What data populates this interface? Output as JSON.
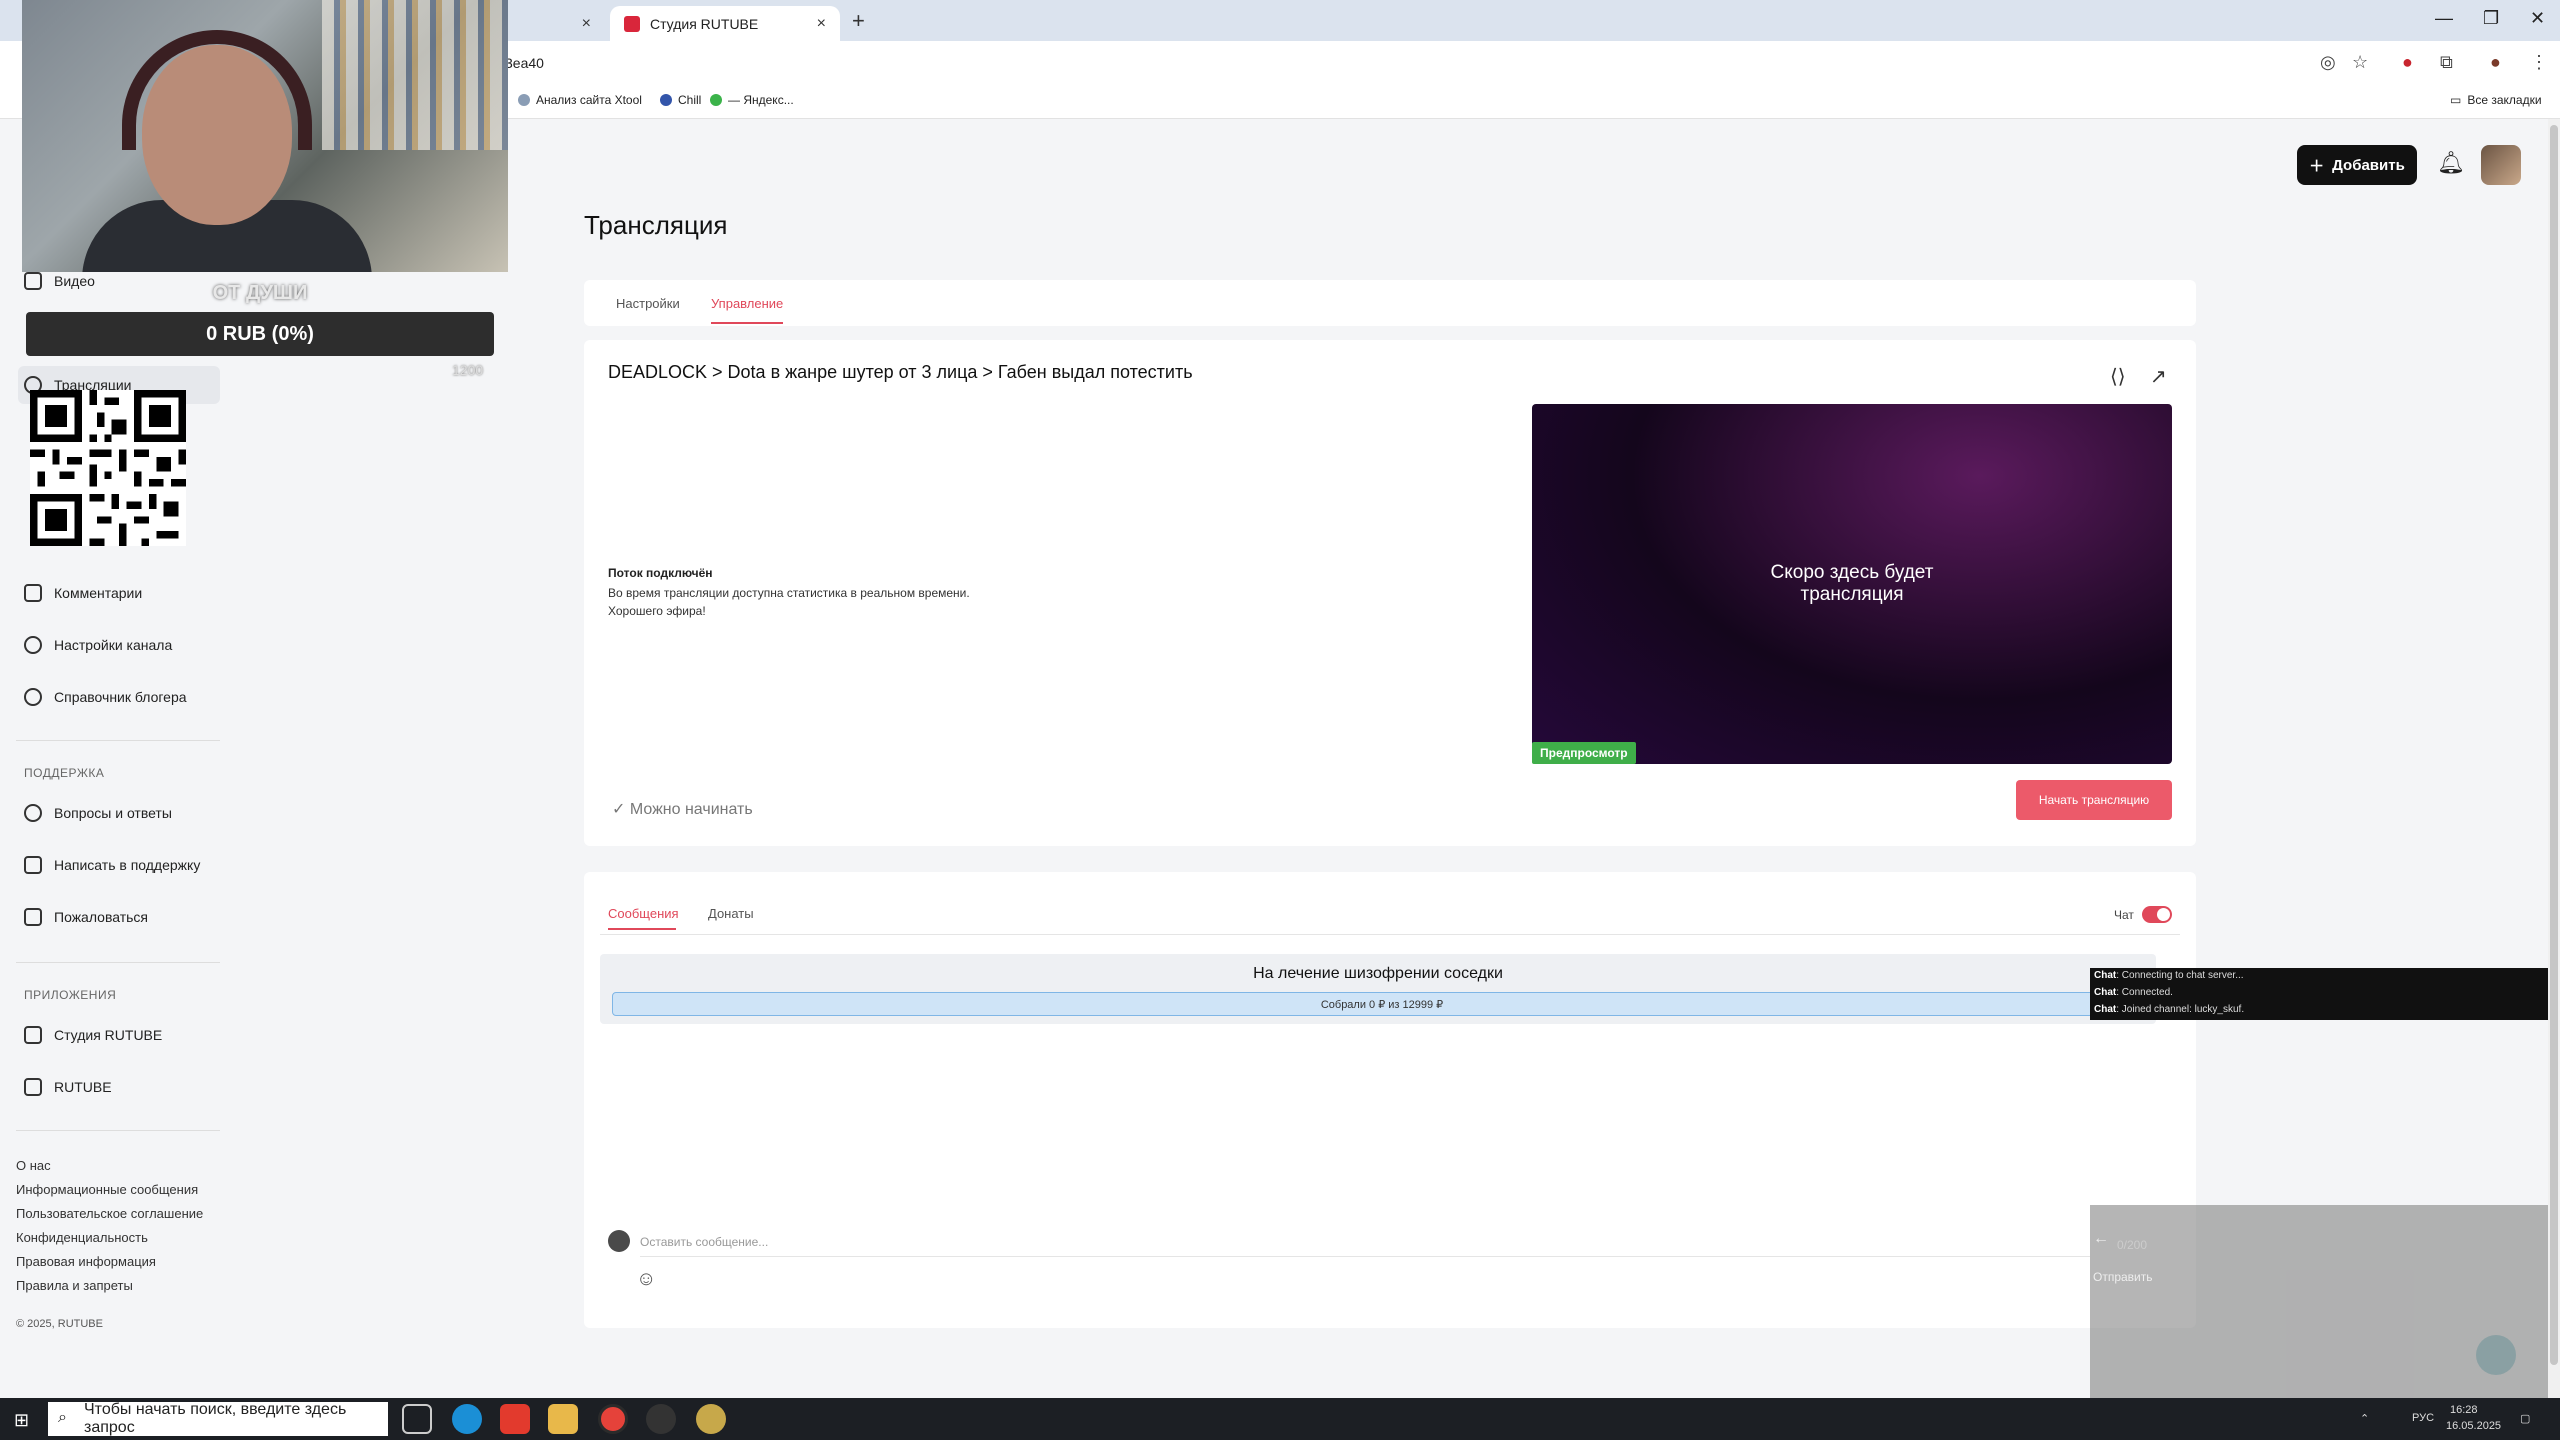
{
  "browser": {
    "tabs": [
      {
        "label": "",
        "close": "×"
      },
      {
        "label": "Студия RUTUBE",
        "close": "×"
      }
    ],
    "new_tab": "+",
    "window_controls": {
      "minimize": "—",
      "restore": "❐",
      "close": "✕"
    },
    "url_fragment": "3ea40",
    "bookmarks": [
      {
        "label": "Анализ сайта Xtool"
      },
      {
        "label": "Chill"
      },
      {
        "label": "— Яндекс..."
      }
    ],
    "all_bookmarks": "Все закладки"
  },
  "sidebar": {
    "items": [
      {
        "label": "Видео",
        "icon": "video-icon"
      },
      {
        "label": "Трансляции",
        "icon": "broadcast-icon",
        "active": true
      },
      {
        "label": "Комментарии",
        "icon": "comment-icon"
      },
      {
        "label": "Настройки канала",
        "icon": "gear-icon"
      },
      {
        "label": "Справочник блогера",
        "icon": "info-icon"
      }
    ],
    "support_heading": "ПОДДЕРЖКА",
    "support_items": [
      {
        "label": "Вопросы и ответы",
        "icon": "question-icon"
      },
      {
        "label": "Написать в поддержку",
        "icon": "mail-icon"
      },
      {
        "label": "Пожаловаться",
        "icon": "flag-icon"
      }
    ],
    "apps_heading": "ПРИЛОЖЕНИЯ",
    "app_items": [
      {
        "label": "Студия RUTUBE",
        "icon": "rutube-studio-icon"
      },
      {
        "label": "RUTUBE",
        "icon": "rutube-icon"
      }
    ],
    "footer_links": [
      "О нас",
      "Информационные сообщения",
      "Пользовательское соглашение",
      "Конфиденциальность",
      "Правовая информация",
      "Правила и запреты"
    ],
    "copyright": "© 2025, RUTUBE"
  },
  "overlay": {
    "donation_title": "ОТ ДУШИ",
    "donation_amount": "0 RUB (0%)",
    "donation_goal": "1200"
  },
  "header": {
    "add_button": "Добавить"
  },
  "page": {
    "title": "Трансляция",
    "tabs": [
      {
        "label": "Настройки"
      },
      {
        "label": "Управление",
        "active": true
      }
    ]
  },
  "stream": {
    "breadcrumb": "DEADLOCK  >  Dota в жанре шутер от 3 лица  >  Габен выдал потестить",
    "status_title": "Поток подключён",
    "status_line1": "Во время трансляции доступна статистика в реальном времени.",
    "status_line2": "Хорошего эфира!",
    "preview_text": "Скоро здесь будет трансляция",
    "preview_badge": "Предпросмотр",
    "ready_label": "Можно начинать",
    "start_button": "Начать трансляцию"
  },
  "chat": {
    "tabs": [
      {
        "label": "Сообщения",
        "active": true
      },
      {
        "label": "Донаты"
      }
    ],
    "toggle_label": "Чат",
    "toggle_on": true,
    "fundraiser_title": "На лечение шизофрении соседки",
    "fundraiser_progress": "Собрали 0 ₽ из 12999 ₽",
    "fundraiser_collected": 0,
    "fundraiser_target": 12999,
    "input_placeholder": "Оставить сообщение..."
  },
  "chat_log": [
    {
      "prefix": "Chat",
      "text": "Connecting to chat server..."
    },
    {
      "prefix": "Chat",
      "text": "Connected."
    },
    {
      "prefix": "Chat",
      "text": "Joined channel: lucky_skuf."
    }
  ],
  "grey_overlay": {
    "count": "0/200",
    "send": "Отправить"
  },
  "taskbar": {
    "search_placeholder": "Чтобы начать поиск, введите здесь запрос",
    "lang": "РУС",
    "time": "16:28",
    "date": "16.05.2025"
  },
  "colors": {
    "accent": "#e0485a",
    "start_button": "#ec5a6a",
    "preview_badge": "#3fae49"
  }
}
